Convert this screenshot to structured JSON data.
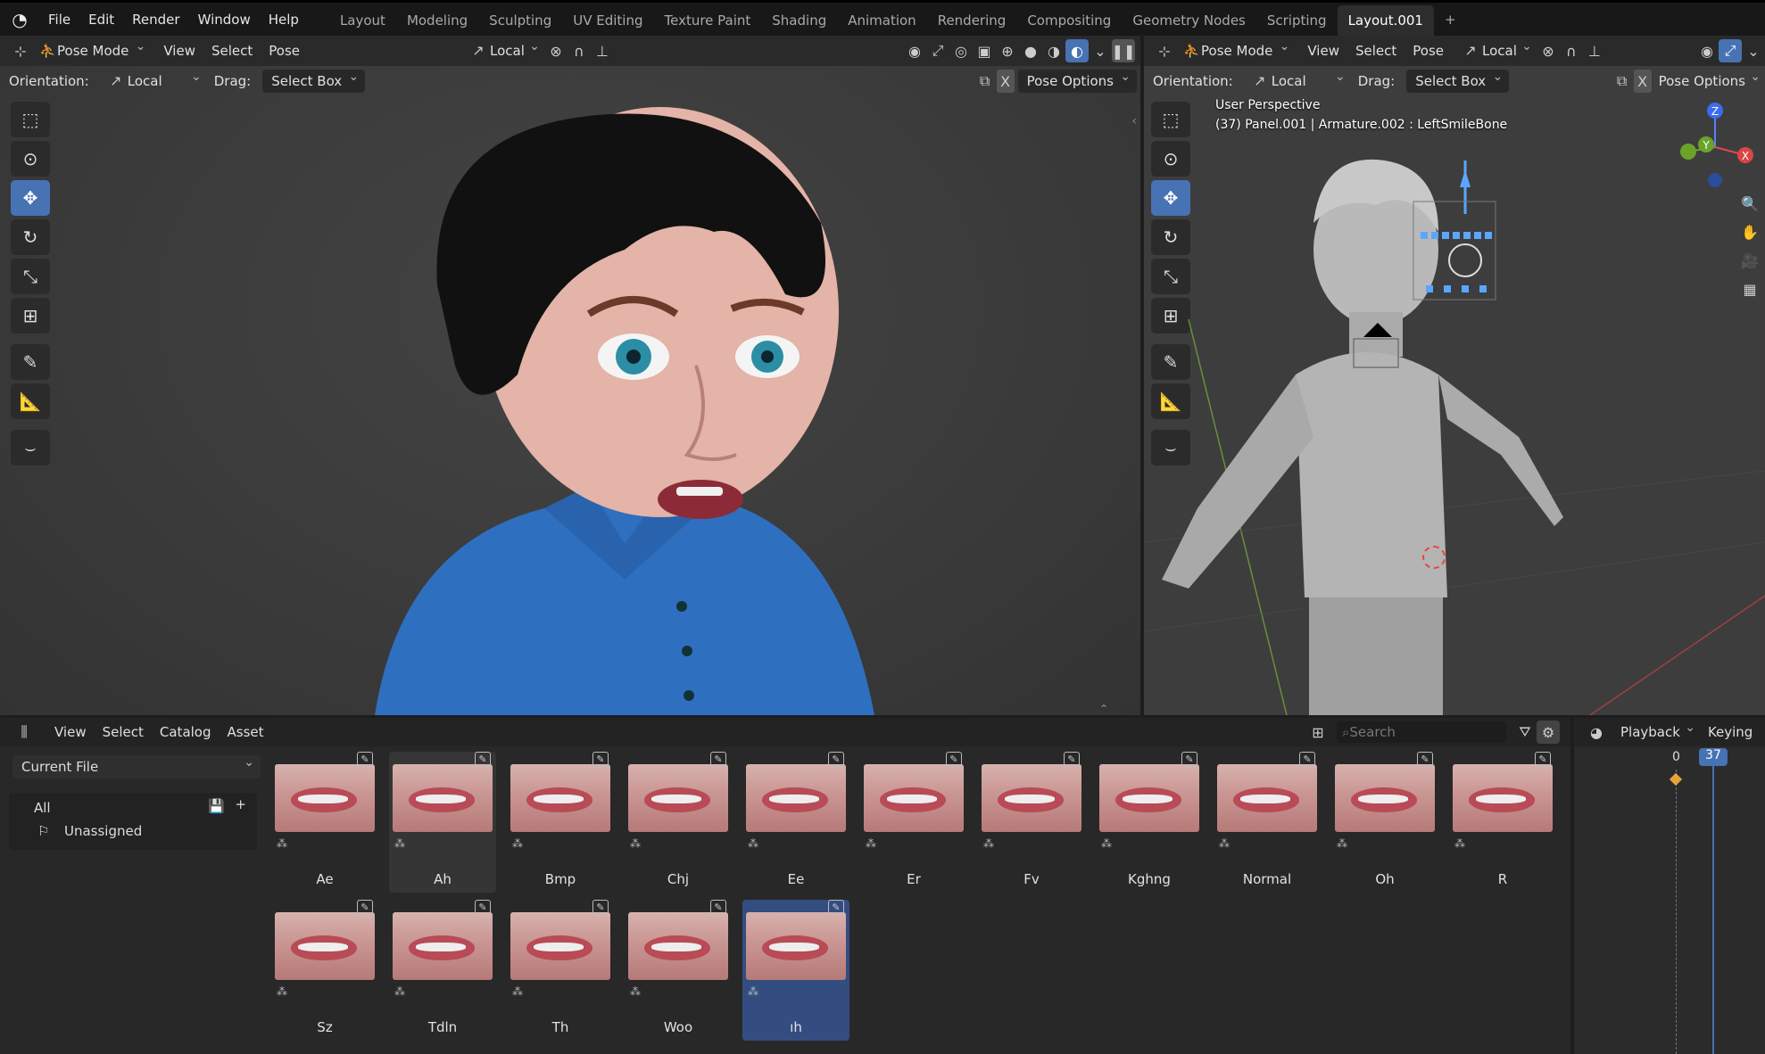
{
  "topbar": {
    "menus": [
      "File",
      "Edit",
      "Render",
      "Window",
      "Help"
    ],
    "workspaces": [
      "Layout",
      "Modeling",
      "Sculpting",
      "UV Editing",
      "Texture Paint",
      "Shading",
      "Animation",
      "Rendering",
      "Compositing",
      "Geometry Nodes",
      "Scripting",
      "Layout.001"
    ],
    "active_workspace": "Layout.001",
    "add_tab": "+"
  },
  "viewport_left": {
    "mode": "Pose Mode",
    "menus": [
      "View",
      "Select",
      "Pose"
    ],
    "transform_orientation": "Local",
    "orientation_label": "Orientation:",
    "orientation_value": "Local",
    "drag_label": "Drag:",
    "drag_value": "Select Box",
    "x_toggle": "X",
    "options": "Pose Options"
  },
  "viewport_right": {
    "mode": "Pose Mode",
    "menus": [
      "View",
      "Select",
      "Pose"
    ],
    "transform_orientation": "Local",
    "orientation_label": "Orientation:",
    "orientation_value": "Local",
    "drag_label": "Drag:",
    "drag_value": "Select Box",
    "x_toggle": "X",
    "options": "Pose Options",
    "overlay_line1": "User Perspective",
    "overlay_line2": "(37) Panel.001 | Armature.002 : LeftSmileBone",
    "gizmo_z": "Z",
    "gizmo_y": "Y",
    "gizmo_x": "X"
  },
  "asset_browser": {
    "menus": [
      "View",
      "Select",
      "Catalog",
      "Asset"
    ],
    "library": "Current File",
    "catalogs": [
      {
        "label": "All"
      },
      {
        "label": "Unassigned"
      }
    ],
    "search_placeholder": "Search",
    "assets_row1": [
      "Ae",
      "Ah",
      "Bmp",
      "Chj",
      "Ee",
      "Er",
      "Fv",
      "Kghng",
      "Normal",
      "Oh",
      "R"
    ],
    "assets_row2": [
      "Sz",
      "Tdln",
      "Th",
      "Woo",
      "ıh"
    ],
    "selected_asset": "ıh",
    "hovered_asset": "Ah"
  },
  "timeline": {
    "menus": [
      "Playback",
      "Keying"
    ],
    "frame_start_label": "0",
    "current_frame": "37"
  },
  "colors": {
    "accent": "#4772b3",
    "selected_asset_bg": "#334d80",
    "viewport_bg": "#3d3d3d",
    "shirt_blue": "#2f6fbf"
  }
}
